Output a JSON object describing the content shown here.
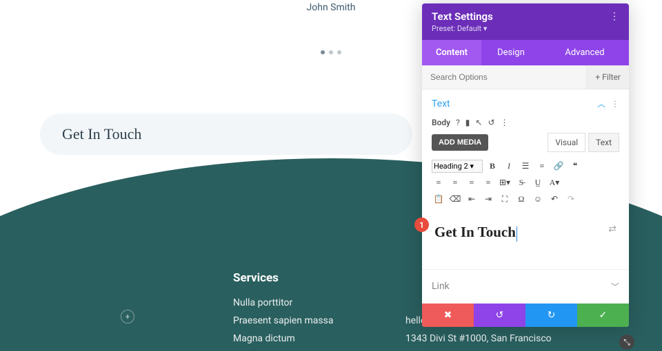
{
  "page": {
    "author": "John Smith",
    "pill_text": "Get In Touch"
  },
  "footer": {
    "services_heading": "Services",
    "services": [
      "Nulla porttitor",
      "Praesent sapien massa",
      "Magna dictum"
    ],
    "contact": [
      "hello@divitherapy.com",
      "1343 Divi St #1000, San Francisco"
    ]
  },
  "panel": {
    "title": "Text Settings",
    "preset": "Preset: Default ▾",
    "tabs": {
      "content": "Content",
      "design": "Design",
      "advanced": "Advanced"
    },
    "search_placeholder": "Search Options",
    "filter_label": "Filter",
    "sections": {
      "text_label": "Text",
      "body_label": "Body",
      "link_label": "Link"
    },
    "editor": {
      "add_media": "ADD MEDIA",
      "visual_tab": "Visual",
      "text_tab": "Text",
      "heading_select": "Heading 2",
      "content": "Get In Touch"
    },
    "badge": "1"
  }
}
